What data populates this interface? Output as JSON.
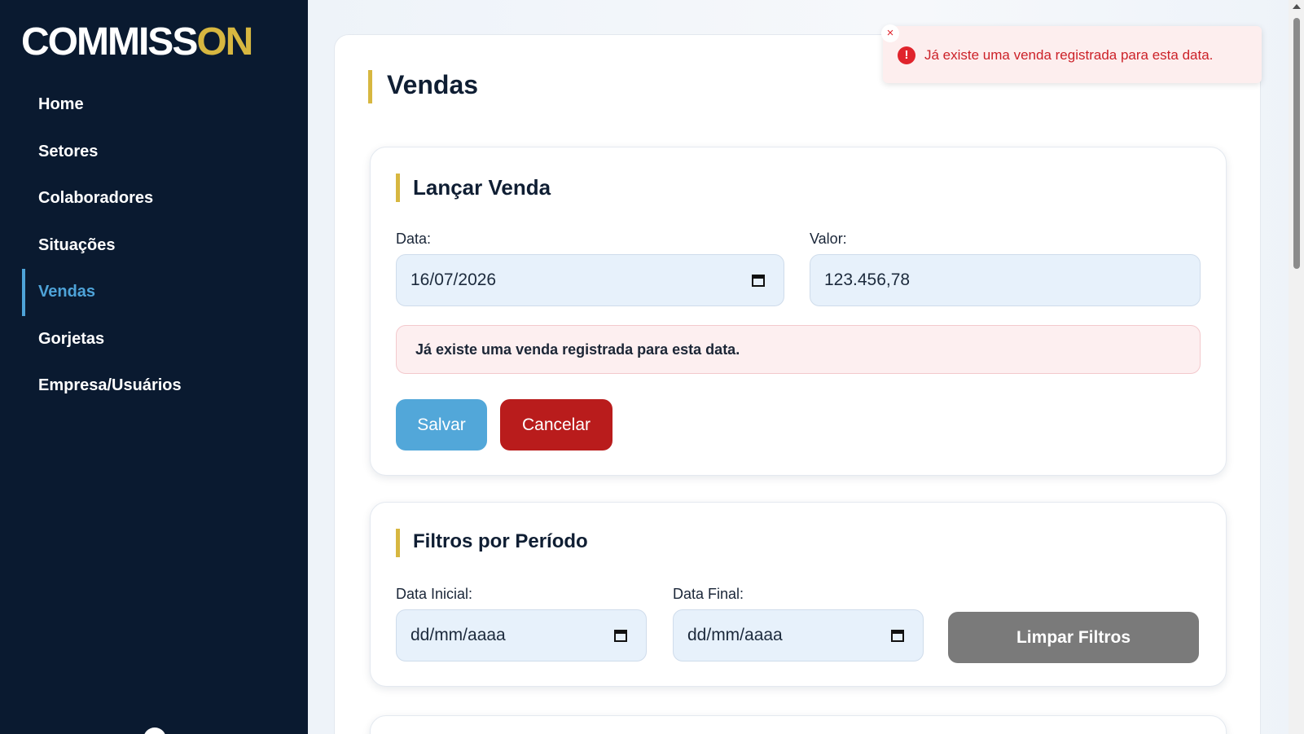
{
  "brand": {
    "part1": "COMMISS",
    "part2": "ON",
    "accent_color": "#d7b740"
  },
  "sidebar": {
    "items": [
      {
        "label": "Home",
        "active": false
      },
      {
        "label": "Setores",
        "active": false
      },
      {
        "label": "Colaboradores",
        "active": false
      },
      {
        "label": "Situações",
        "active": false
      },
      {
        "label": "Vendas",
        "active": true
      },
      {
        "label": "Gorjetas",
        "active": false
      },
      {
        "label": "Empresa/Usuários",
        "active": false
      }
    ]
  },
  "page": {
    "title": "Vendas"
  },
  "launch_sale": {
    "title": "Lançar Venda",
    "date_label": "Data:",
    "date_value": "16/07/2026",
    "value_label": "Valor:",
    "value_value": "123.456,78",
    "error_message": "Já existe uma venda registrada para esta data.",
    "save_label": "Salvar",
    "cancel_label": "Cancelar"
  },
  "filters": {
    "title": "Filtros por Período",
    "start_label": "Data Inicial:",
    "start_placeholder": "dd/mm/aaaa",
    "end_label": "Data Final:",
    "end_placeholder": "dd/mm/aaaa",
    "clear_label": "Limpar Filtros"
  },
  "toast": {
    "close_symbol": "×",
    "icon_symbol": "!",
    "message": "Já existe uma venda registrada para esta data."
  },
  "colors": {
    "sidebar_bg": "#0a1a30",
    "active_nav": "#4ea3d8",
    "save_button": "#52a7d9",
    "cancel_button": "#b91c1c",
    "clear_button": "#7a7a7a",
    "error_text": "#cc2128"
  }
}
